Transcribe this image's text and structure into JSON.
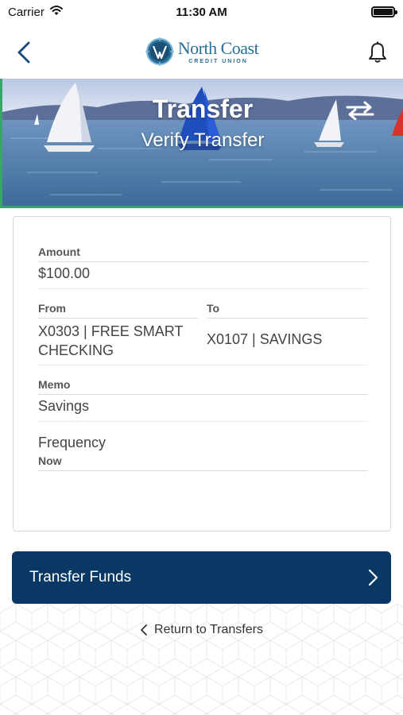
{
  "status_bar": {
    "carrier": "Carrier",
    "time": "11:30 AM",
    "icons": [
      "wifi-icon",
      "battery-icon"
    ]
  },
  "header": {
    "logo_name": "North Coast",
    "logo_sub": "CREDIT UNION",
    "icons": [
      "back-chevron-icon",
      "bell-icon"
    ]
  },
  "banner": {
    "title": "Transfer",
    "subtitle": "Verify Transfer",
    "icon": "transfer-arrows-icon"
  },
  "details": {
    "amount": {
      "label": "Amount",
      "value": "$100.00"
    },
    "from": {
      "label": "From",
      "value": "X0303 | FREE SMART CHECKING"
    },
    "to": {
      "label": "To",
      "value": "X0107 | SAVINGS"
    },
    "memo": {
      "label": "Memo",
      "value": "Savings"
    },
    "frequency": {
      "label": "Frequency",
      "value": "Now"
    }
  },
  "actions": {
    "submit_label": "Transfer Funds",
    "return_label": "Return to Transfers"
  },
  "colors": {
    "primary": "#083863",
    "brand": "#2a6f9a",
    "banner_accent": "#3aa56a"
  }
}
